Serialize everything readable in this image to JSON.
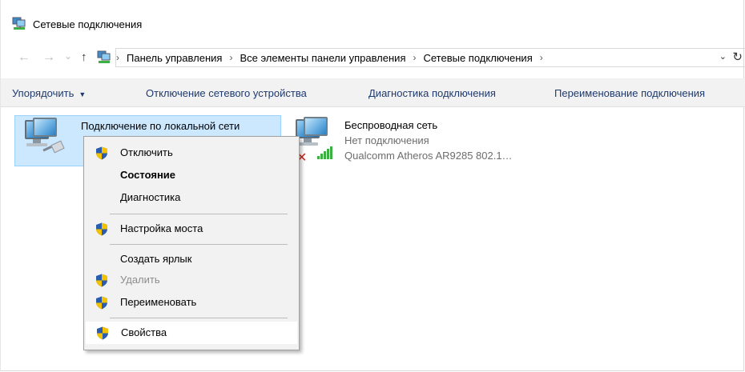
{
  "window": {
    "title": "Сетевые подключения",
    "title_icon": "network-connections-icon"
  },
  "nav": {
    "back_icon": "←",
    "forward_icon": "→",
    "recent_icon": "⌄",
    "up_icon": "↑",
    "breadcrumb": [
      "Панель управления",
      "Все элементы панели управления",
      "Сетевые подключения"
    ],
    "crumb_separator": "›",
    "dropdown_icon": "⌄",
    "refresh_icon": "↻"
  },
  "commands": {
    "organize": "Упорядочить",
    "organize_caret": "▼",
    "disable": "Отключение сетевого устройства",
    "diagnose": "Диагностика подключения",
    "rename": "Переименование подключения"
  },
  "connections": [
    {
      "name": "Подключение по локальной сети",
      "icon": "ethernet-adapter-icon",
      "selected": true
    },
    {
      "name": "Беспроводная сеть",
      "status": "Нет подключения",
      "device": "Qualcomm Atheros AR9285 802.1…",
      "icon": "wireless-adapter-icon",
      "status_mark": "✕"
    }
  ],
  "context_menu": {
    "items": [
      {
        "label": "Отключить",
        "shield": true
      },
      {
        "label": "Состояние",
        "bold": true
      },
      {
        "label": "Диагностика"
      },
      {
        "label": "Настройка моста",
        "shield": true
      },
      {
        "label": "Создать ярлык"
      },
      {
        "label": "Удалить",
        "shield": true,
        "disabled": true
      },
      {
        "label": "Переименовать",
        "shield": true
      },
      {
        "label": "Свойства",
        "shield": true,
        "highlighted": true
      }
    ]
  },
  "colors": {
    "selection_bg": "#cce8ff",
    "selection_border": "#99d1ff",
    "command_text": "#1f3a6e",
    "menu_bg": "#f2f2f2",
    "shield_blue": "#2a5db0",
    "shield_yellow": "#f2c200"
  }
}
